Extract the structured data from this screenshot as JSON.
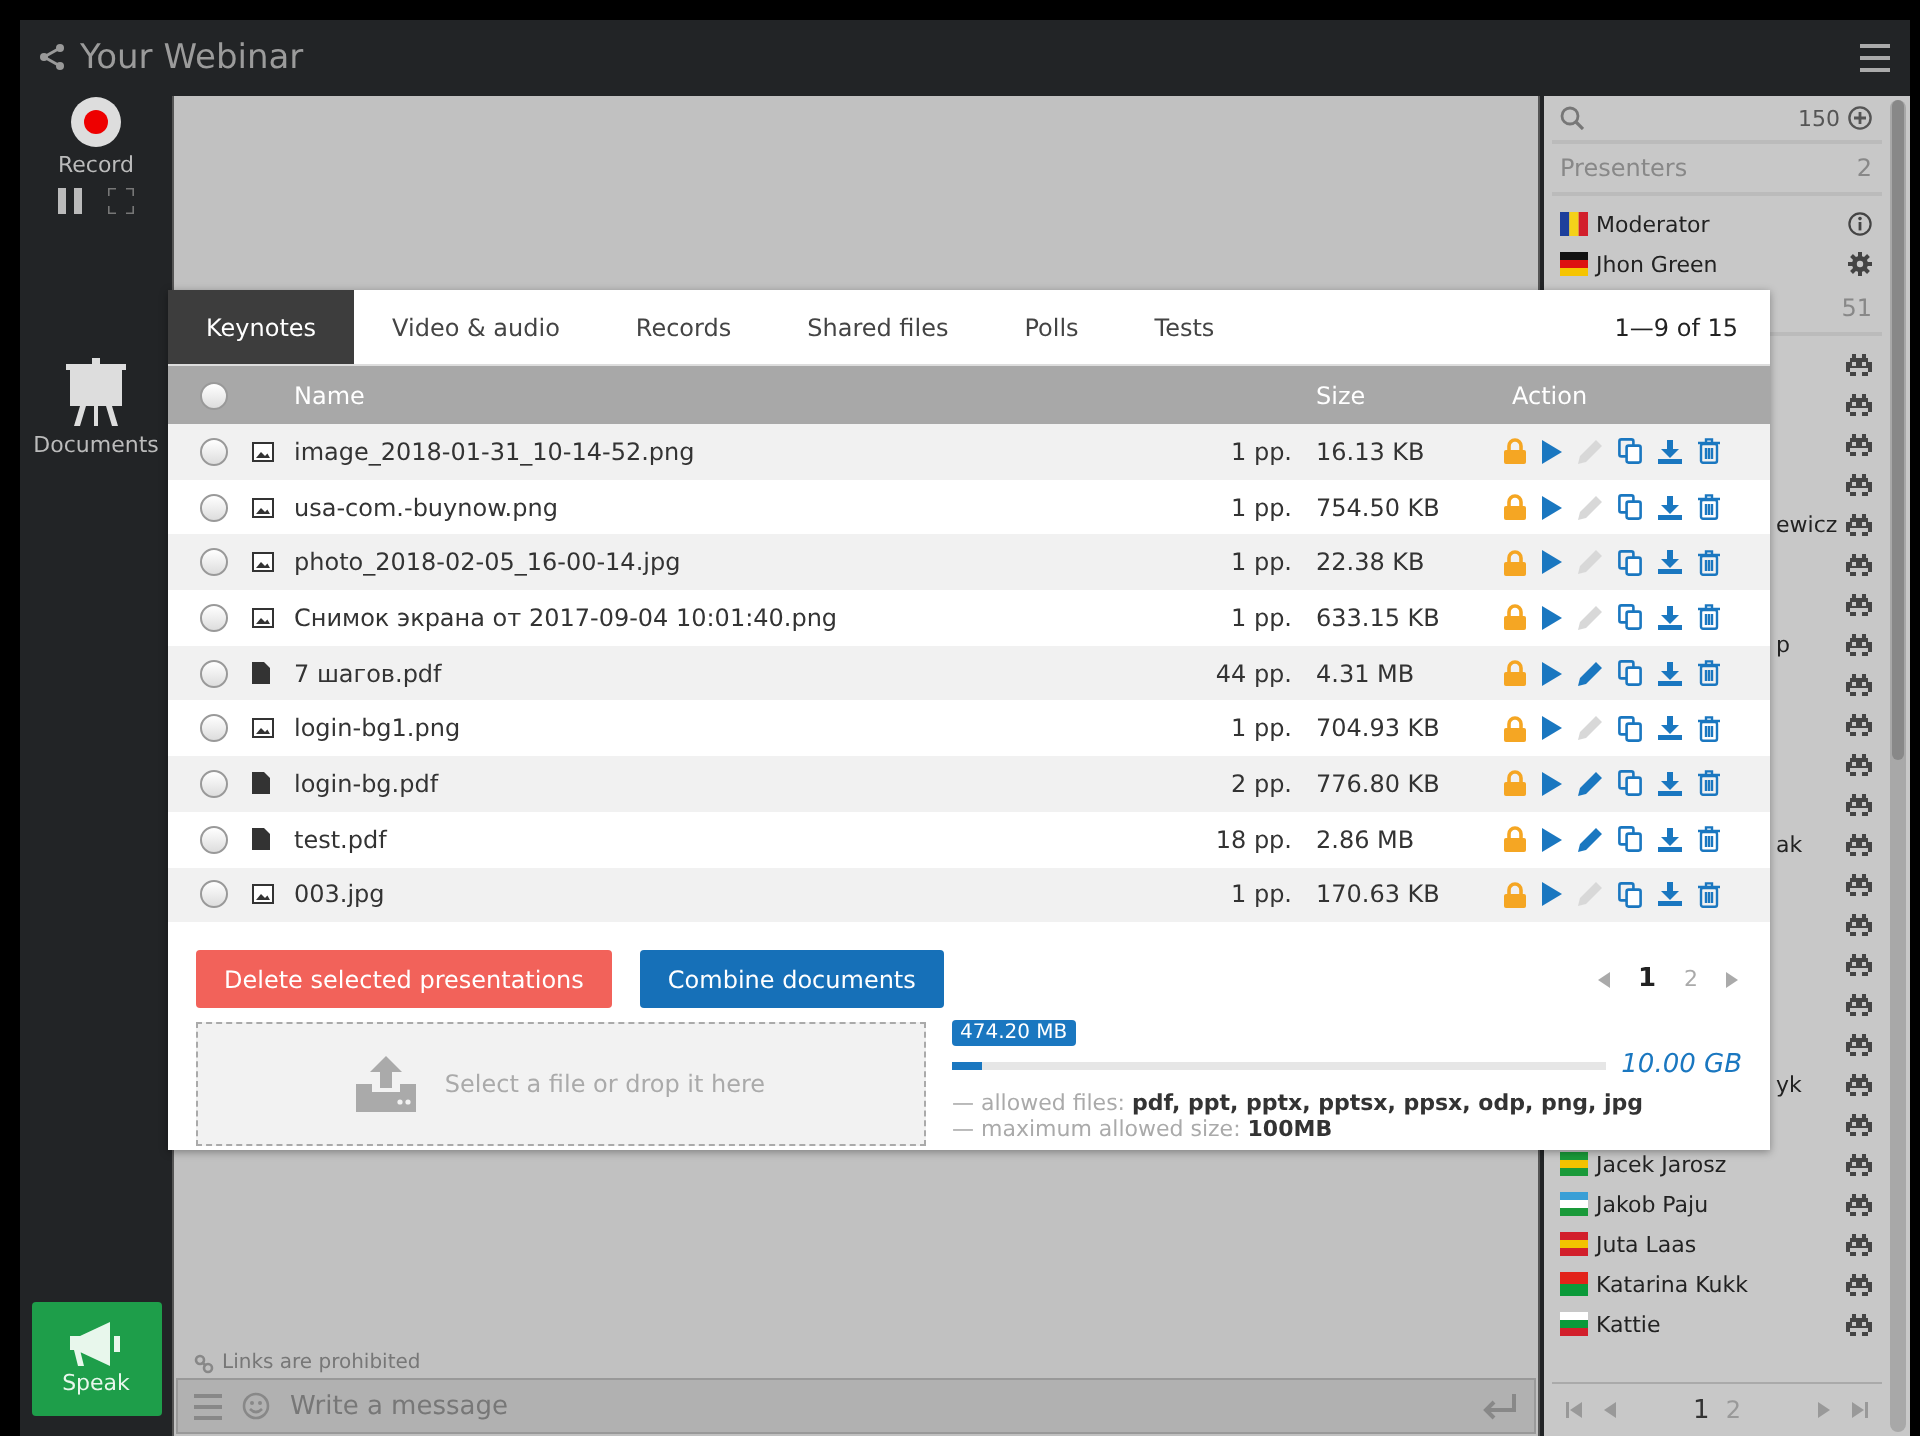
{
  "window": {
    "title": "Your Webinar"
  },
  "left_bar": {
    "record": {
      "label": "Record",
      "recording": true
    },
    "documents": {
      "label": "Documents"
    },
    "speak": {
      "label": "Speak"
    }
  },
  "people": {
    "count": "150",
    "presenters": {
      "label": "Presenters",
      "count": "2"
    },
    "presenter_list": [
      {
        "name": "Moderator",
        "kind": "info"
      },
      {
        "name": "Jhon Green",
        "kind": "settings"
      }
    ],
    "attendees_count": "51",
    "attendees": [
      {
        "kind": "hidden"
      },
      {
        "kind": "hidden"
      },
      {
        "kind": "hidden"
      },
      {
        "kind": "hidden"
      },
      {
        "kind": "cut",
        "name": "ewicz"
      },
      {
        "kind": "hidden"
      },
      {
        "kind": "hidden"
      },
      {
        "kind": "cut",
        "name": "p"
      },
      {
        "kind": "hidden"
      },
      {
        "kind": "hidden"
      },
      {
        "kind": "hidden"
      },
      {
        "kind": "hidden"
      },
      {
        "kind": "cut",
        "name": "ak"
      },
      {
        "kind": "hidden"
      },
      {
        "kind": "hidden"
      },
      {
        "kind": "hidden"
      },
      {
        "kind": "hidden"
      },
      {
        "kind": "hidden"
      },
      {
        "kind": "cut",
        "name": "yk"
      },
      {
        "kind": "hidden"
      },
      {
        "kind": "flagged",
        "name": "Jacek Jarosz"
      },
      {
        "kind": "flagged",
        "name": "Jakob Paju"
      },
      {
        "kind": "flagged",
        "name": "Juta Laas"
      },
      {
        "kind": "flagged",
        "name": "Katarina Kukk"
      },
      {
        "kind": "flagged",
        "name": "Kattie"
      }
    ],
    "pages": [
      {
        "label": "1",
        "selected": true
      },
      {
        "label": "2",
        "selected": false
      }
    ]
  },
  "chat": {
    "notice": "Links are prohibited",
    "placeholder": "Write a message"
  },
  "documents_dialog": {
    "tabs": [
      {
        "label": "Keynotes",
        "selected": true
      },
      {
        "label": "Video & audio",
        "selected": false
      },
      {
        "label": "Records",
        "selected": false
      },
      {
        "label": "Shared files",
        "selected": false
      },
      {
        "label": "Polls",
        "selected": false
      },
      {
        "label": "Tests",
        "selected": false
      }
    ],
    "range": "1—9 of 15",
    "columns": [
      "Name",
      "Size",
      "Action"
    ],
    "all_checked": false,
    "rows": [
      {
        "kind": "image",
        "name": "image_2018-01-31_10-14-52.png",
        "pages": "1 pp.",
        "size": "16.13 KB",
        "checked": false,
        "editable": false
      },
      {
        "kind": "image",
        "name": "usa-com.-buynow.png",
        "pages": "1 pp.",
        "size": "754.50 KB",
        "checked": false,
        "editable": false
      },
      {
        "kind": "image",
        "name": "photo_2018-02-05_16-00-14.jpg",
        "pages": "1 pp.",
        "size": "22.38 KB",
        "checked": false,
        "editable": false
      },
      {
        "kind": "image",
        "name": "Снимок экрана от 2017-09-04 10:01:40.png",
        "pages": "1 pp.",
        "size": "633.15 KB",
        "checked": false,
        "editable": false
      },
      {
        "kind": "document",
        "name": "7 шагов.pdf",
        "pages": "44 pp.",
        "size": "4.31 MB",
        "checked": false,
        "editable": true
      },
      {
        "kind": "image",
        "name": "login-bg1.png",
        "pages": "1 pp.",
        "size": "704.93 KB",
        "checked": false,
        "editable": false
      },
      {
        "kind": "document",
        "name": "login-bg.pdf",
        "pages": "2 pp.",
        "size": "776.80 KB",
        "checked": false,
        "editable": true
      },
      {
        "kind": "document",
        "name": "test.pdf",
        "pages": "18 pp.",
        "size": "2.86 MB",
        "checked": false,
        "editable": true
      },
      {
        "kind": "image",
        "name": "003.jpg",
        "pages": "1 pp.",
        "size": "170.63 KB",
        "checked": false,
        "editable": false
      }
    ],
    "delete_button": "Delete selected presentations",
    "combine_button": "Combine documents",
    "pages": [
      {
        "label": "1",
        "selected": true
      },
      {
        "label": "2",
        "selected": false
      }
    ],
    "upload": {
      "label": "Select a file or drop it here"
    },
    "storage": {
      "used": "474.20 MB",
      "total": "10.00 GB",
      "level": 0.046
    },
    "notes": [
      "— allowed files: **pdf, ppt, pptx, pptsx, ppsx, odp, png, jpg**",
      "— maximum allowed size: **100MB**"
    ]
  }
}
